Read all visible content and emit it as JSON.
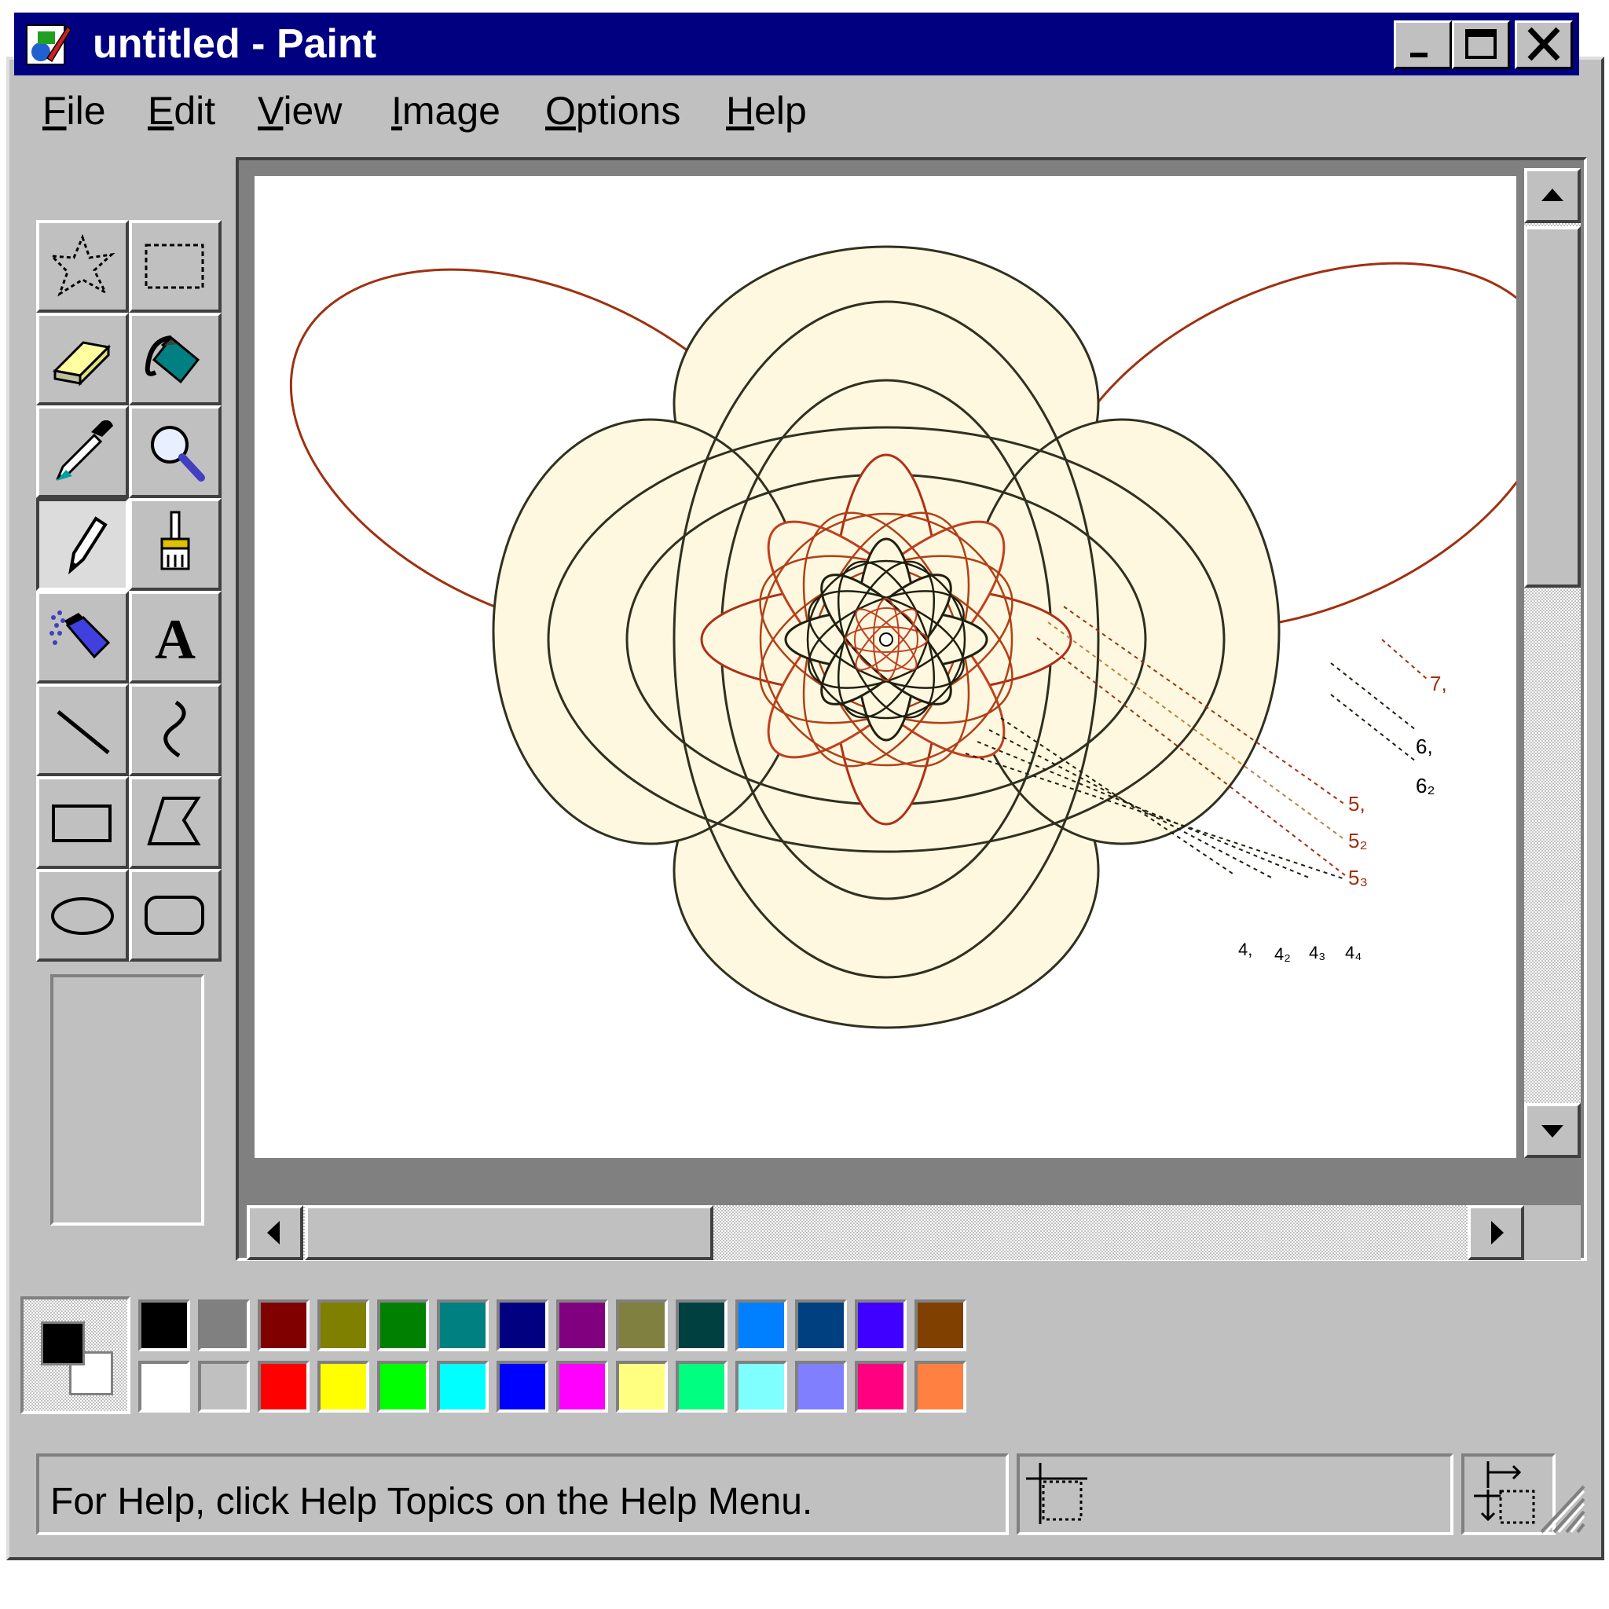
{
  "window": {
    "title": "untitled - Paint",
    "controls": [
      "minimize",
      "maximize",
      "close"
    ]
  },
  "menu": {
    "items": [
      {
        "label": "File",
        "key": "F"
      },
      {
        "label": "Edit",
        "key": "E"
      },
      {
        "label": "View",
        "key": "V"
      },
      {
        "label": "Image",
        "key": "I"
      },
      {
        "label": "Options",
        "key": "O"
      },
      {
        "label": "Help",
        "key": "H"
      }
    ]
  },
  "tools": [
    {
      "name": "free-form-select",
      "icon": "free-form-select-icon"
    },
    {
      "name": "select",
      "icon": "select-icon"
    },
    {
      "name": "eraser",
      "icon": "eraser-icon"
    },
    {
      "name": "fill-with-color",
      "icon": "paint-bucket-icon"
    },
    {
      "name": "pick-color",
      "icon": "eyedropper-icon"
    },
    {
      "name": "magnifier",
      "icon": "magnifier-icon"
    },
    {
      "name": "pencil",
      "icon": "pencil-icon",
      "selected": true
    },
    {
      "name": "brush",
      "icon": "brush-icon"
    },
    {
      "name": "airbrush",
      "icon": "airbrush-icon"
    },
    {
      "name": "text",
      "icon": "text-icon",
      "glyph": "A"
    },
    {
      "name": "line",
      "icon": "line-icon"
    },
    {
      "name": "curve",
      "icon": "curve-icon"
    },
    {
      "name": "rectangle",
      "icon": "rectangle-icon"
    },
    {
      "name": "polygon",
      "icon": "polygon-icon"
    },
    {
      "name": "ellipse",
      "icon": "ellipse-icon"
    },
    {
      "name": "rounded-rectangle",
      "icon": "rounded-rectangle-icon"
    }
  ],
  "canvas": {
    "labels": {
      "l7": "7,",
      "l61": "6,",
      "l62": "6₂",
      "l51": "5,",
      "l52": "5₂",
      "l53": "5₃",
      "l41": "4,",
      "l42": "4₂",
      "l43": "4₃",
      "l44": "4₄"
    }
  },
  "palette": {
    "foreground": "#000000",
    "background": "#ffffff",
    "row1": [
      "#000000",
      "#808080",
      "#800000",
      "#808000",
      "#008000",
      "#008080",
      "#000080",
      "#800080",
      "#808040",
      "#004040",
      "#0080ff",
      "#004080",
      "#4000ff",
      "#804000"
    ],
    "row2": [
      "#ffffff",
      "#c0c0c0",
      "#ff0000",
      "#ffff00",
      "#00ff00",
      "#00ffff",
      "#0000ff",
      "#ff00ff",
      "#ffff80",
      "#00ff80",
      "#80ffff",
      "#8080ff",
      "#ff0080",
      "#ff8040"
    ]
  },
  "status": {
    "help_text": "For Help, click Help Topics on the Help Menu."
  },
  "colors": {
    "title_bar": "#000080",
    "face": "#c0c0c0"
  }
}
